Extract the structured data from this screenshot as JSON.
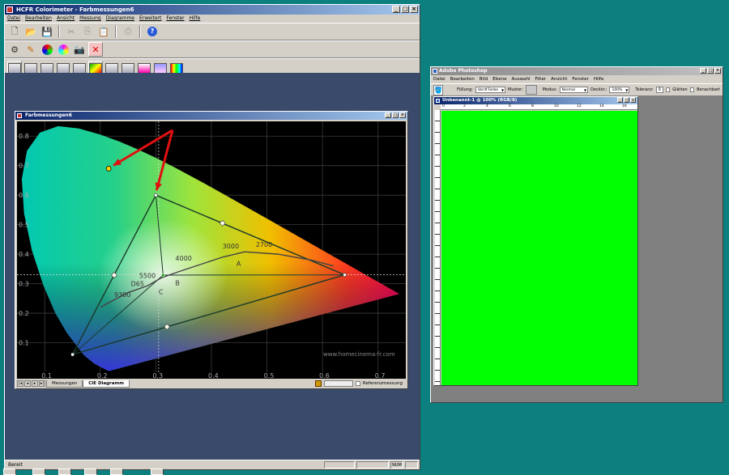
{
  "colors": {
    "desktop": "#0c7f7f",
    "mdi": "#3a4a6b",
    "green_canvas": "#00ff00",
    "ps_workspace": "#808080"
  },
  "hcfr": {
    "title": "HCFR Colorimeter - Farbmessungen6",
    "menu": [
      "Datei",
      "Bearbeiten",
      "Ansicht",
      "Messung",
      "Diagramme",
      "Erweitert",
      "Fenster",
      "Hilfe"
    ],
    "toolbar1_icons": [
      "new-icon",
      "open-icon",
      "save-icon",
      "cut-icon",
      "copy-icon",
      "paste-icon",
      "print-icon",
      "help-icon"
    ],
    "toolbar2_icons": [
      "sensor-icon",
      "generator-icon",
      "rgb-icon",
      "colors-icon",
      "camera-icon",
      "stop-icon"
    ],
    "status_left": "Bereit",
    "status_right": "NUM"
  },
  "chart_window": {
    "title": "Farbmessungen6",
    "tabs": [
      "Messungen",
      "CIE Diagramm"
    ],
    "active_tab": "CIE Diagramm",
    "reference_label": "Referenzmessung",
    "watermark": "www.homecinema-fr.com"
  },
  "chart_data": {
    "type": "scatter",
    "title": "",
    "xlim": [
      0.05,
      0.75
    ],
    "ylim": [
      0.0,
      0.85
    ],
    "x_ticks": [
      "0.1",
      "0.2",
      "0.3",
      "0.4",
      "0.5",
      "0.6",
      "0.7"
    ],
    "y_ticks": [
      "0.1",
      "0.2",
      "0.3",
      "0.4",
      "0.5",
      "0.6",
      "0.7",
      "0.8"
    ],
    "grid": true,
    "crosshair": {
      "x": 0.305,
      "y": 0.33
    },
    "gamut_reference": [
      {
        "name": "R",
        "x": 0.64,
        "y": 0.33
      },
      {
        "name": "G",
        "x": 0.3,
        "y": 0.6
      },
      {
        "name": "B",
        "x": 0.15,
        "y": 0.06
      }
    ],
    "measured_green": {
      "x": 0.215,
      "y": 0.69
    },
    "secondaries": [
      {
        "name": "Y",
        "x": 0.42,
        "y": 0.505
      },
      {
        "name": "C",
        "x": 0.225,
        "y": 0.329
      },
      {
        "name": "M",
        "x": 0.32,
        "y": 0.154
      }
    ],
    "white_point": {
      "x": 0.313,
      "y": 0.329
    },
    "blackbody_labels": [
      "9300",
      "D65",
      "5500",
      "4000",
      "3000",
      "2700"
    ],
    "illuminant_labels": [
      "C",
      "B",
      "A"
    ]
  },
  "photoshop": {
    "title": "Adobe Photoshop",
    "menu": [
      "Datei",
      "Bearbeiten",
      "Bild",
      "Ebene",
      "Auswahl",
      "Filter",
      "Ansicht",
      "Fenster",
      "Hilfe"
    ],
    "options": {
      "fill_label": "Füllung:",
      "fill_value": "Vordf.Farbe",
      "pattern_label": "Muster:",
      "mode_label": "Modus:",
      "mode_value": "Normal",
      "opacity_label": "Deckkr.:",
      "opacity_value": "100%",
      "tolerance_label": "Toleranz:",
      "tolerance_value": "0",
      "smooth_label": "Glätten",
      "adjacent_label": "Benachbart"
    },
    "doc_title": "Unbenannt-1 @ 100% (RGB/8)",
    "ruler_marks": [
      "0",
      "2",
      "4",
      "6",
      "8",
      "10",
      "12",
      "14",
      "16"
    ]
  }
}
